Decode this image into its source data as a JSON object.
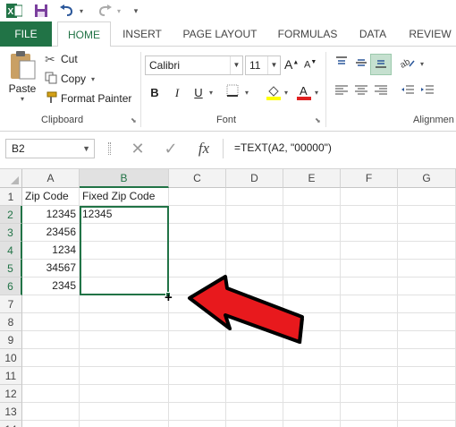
{
  "app": {
    "name": "Excel",
    "accent": "#217346"
  },
  "qat": {
    "icons": [
      "excel-logo-icon",
      "save-icon",
      "undo-icon",
      "redo-icon",
      "customize-icon"
    ]
  },
  "tabs": [
    "FILE",
    "HOME",
    "INSERT",
    "PAGE LAYOUT",
    "FORMULAS",
    "DATA",
    "REVIEW"
  ],
  "ribbon": {
    "clipboard": {
      "paste": "Paste",
      "cut": "Cut",
      "copy": "Copy",
      "format_painter": "Format Painter",
      "label": "Clipboard"
    },
    "font": {
      "name": "Calibri",
      "size": "11",
      "bold": "B",
      "italic": "I",
      "underline": "U",
      "label": "Font",
      "font_color": "#e02020",
      "highlight_color": "#ffff00"
    },
    "alignment": {
      "label": "Alignmen"
    }
  },
  "formula_bar": {
    "name_box": "B2",
    "cancel": "✕",
    "enter": "✓",
    "fx": "fx",
    "formula": "=TEXT(A2, \"00000\")"
  },
  "sheet": {
    "columns": [
      "A",
      "B",
      "C",
      "D",
      "E",
      "F",
      "G"
    ],
    "rows": [
      "1",
      "2",
      "3",
      "4",
      "5",
      "6",
      "7",
      "8",
      "9",
      "10",
      "11",
      "12",
      "13",
      "14"
    ],
    "cells": {
      "A1": "Zip Code",
      "B1": "Fixed Zip Code",
      "A2": "12345",
      "B2": "12345",
      "A3": "23456",
      "A4": "1234",
      "A5": "34567",
      "A6": "2345"
    },
    "selected_cell": "B2",
    "selected_range": "B2:B6"
  },
  "annotation": {
    "arrow_color": "#e8191d"
  }
}
